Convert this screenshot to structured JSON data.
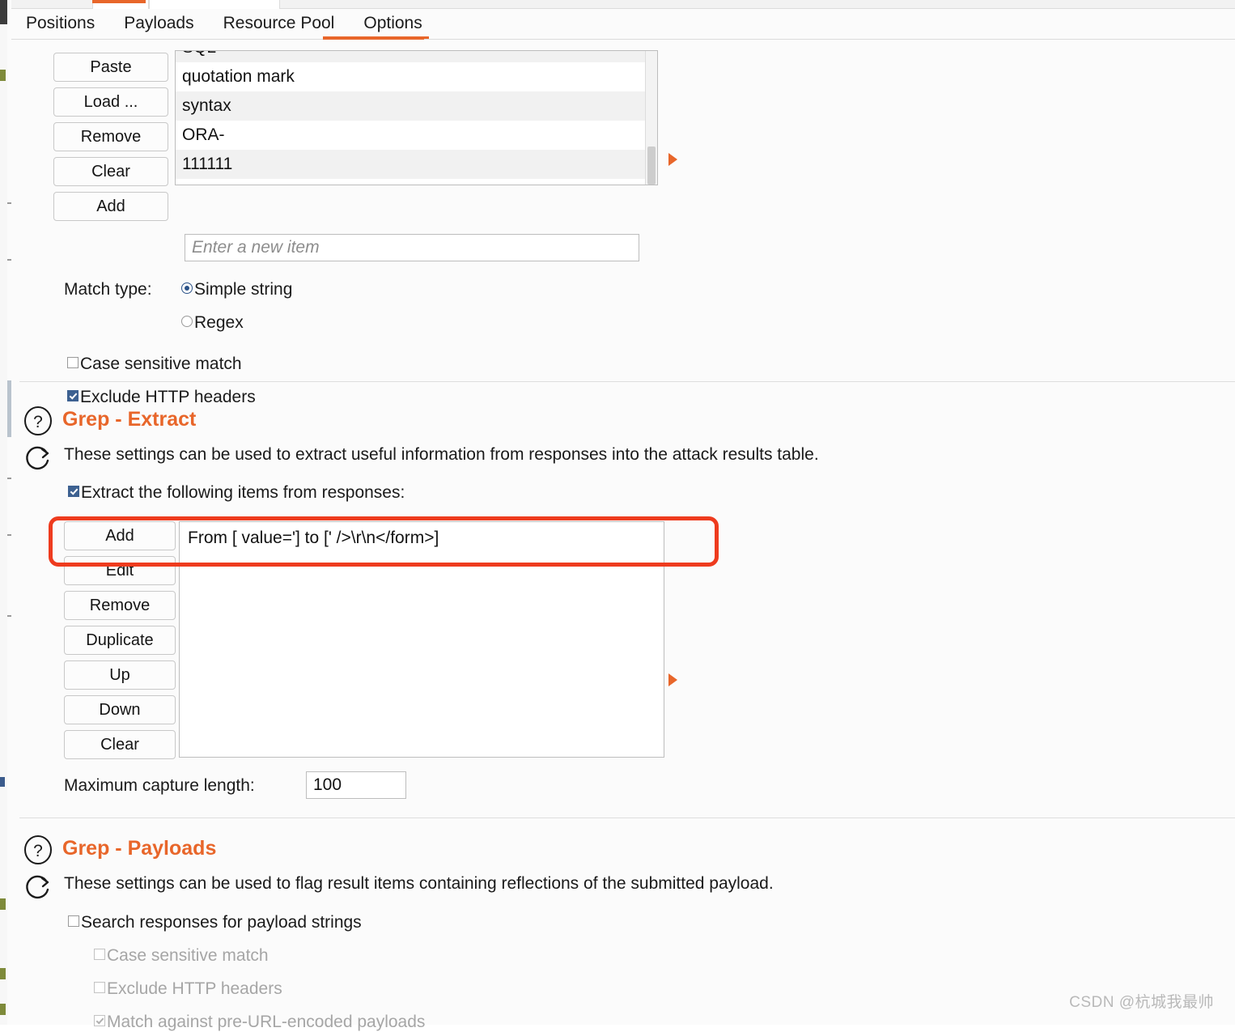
{
  "tabs": [
    {
      "label": "Positions",
      "active": false
    },
    {
      "label": "Payloads",
      "active": false
    },
    {
      "label": "Resource Pool",
      "active": false
    },
    {
      "label": "Options",
      "active": true
    }
  ],
  "grep_match": {
    "buttons": [
      "Paste",
      "Load ...",
      "Remove",
      "Clear",
      "Add"
    ],
    "items": [
      "SQL",
      "quotation mark",
      "syntax",
      "ORA-",
      "111111"
    ],
    "new_item_placeholder": "Enter a new item",
    "new_item_value": "",
    "match_type_label": "Match type:",
    "match_type_options": [
      "Simple string",
      "Regex"
    ],
    "match_type_selected": "Simple string",
    "case_sensitive_label": "Case sensitive match",
    "case_sensitive_checked": false,
    "exclude_headers_label": "Exclude HTTP headers",
    "exclude_headers_checked": true
  },
  "grep_extract": {
    "help_icon": "question-circle-icon",
    "reset_icon": "refresh-icon",
    "title": "Grep - Extract",
    "description": "These settings can be used to extract useful information from responses into the attack results table.",
    "enable_label": "Extract the following items from responses:",
    "enable_checked": true,
    "buttons": [
      "Add",
      "Edit",
      "Remove",
      "Duplicate",
      "Up",
      "Down",
      "Clear"
    ],
    "items": [
      "From [ value='] to [' />\\r\\n</form>]"
    ],
    "max_capture_label": "Maximum capture length:",
    "max_capture_value": "100"
  },
  "grep_payloads": {
    "help_icon": "question-circle-icon",
    "reset_icon": "refresh-icon",
    "title": "Grep - Payloads",
    "description": "These settings can be used to flag result items containing reflections of the submitted payload.",
    "search_label": "Search responses for payload strings",
    "search_checked": false,
    "case_sensitive_label": "Case sensitive match",
    "case_sensitive_checked": false,
    "exclude_headers_label": "Exclude HTTP headers",
    "exclude_headers_checked": false,
    "pre_url_label": "Match against pre-URL-encoded payloads",
    "pre_url_checked": true
  },
  "watermark": "CSDN @杭城我最帅",
  "colors": {
    "accent": "#e8662a",
    "highlight": "#ee3b1e",
    "checkbox": "#3d6191"
  }
}
